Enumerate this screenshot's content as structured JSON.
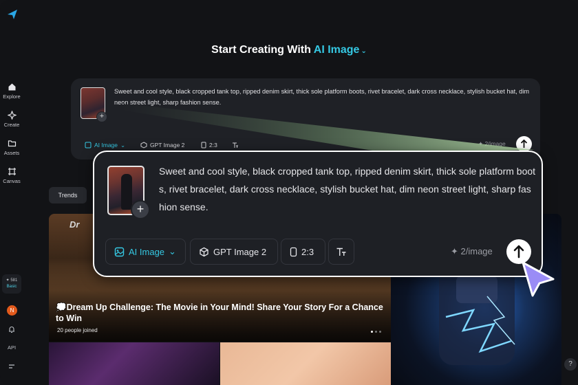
{
  "header": {
    "title_prefix": "Start Creating With",
    "mode": "AI Image"
  },
  "sidebar": {
    "items": [
      {
        "label": "Explore",
        "icon": "home-icon"
      },
      {
        "label": "Create",
        "icon": "sparkle-icon"
      },
      {
        "label": "Assets",
        "icon": "folder-icon"
      },
      {
        "label": "Canvas",
        "icon": "canvas-icon"
      }
    ],
    "credits": {
      "amount": "✦ 581",
      "tier": "Basic"
    },
    "avatar_initial": "N",
    "api_label": "API"
  },
  "prompt": {
    "text": "Sweet and cool style, black cropped tank top, ripped denim skirt, thick sole platform boots, rivet bracelet, dark cross necklace, stylish bucket hat, dim neon street light, sharp fashion sense.",
    "text_small": "Sweet and cool style, black cropped tank top, ripped denim skirt, thick sole platform boots, rivet bracelet, dark cross necklace, stylish bucket hat, dim neon street light, sharp fashion sense.",
    "add_symbol": "+",
    "tools": {
      "mode": "AI Image",
      "model": "GPT Image 2",
      "ratio": "2:3"
    },
    "cost": "✦ 2/image"
  },
  "tabs": {
    "trends": "Trends"
  },
  "feed": {
    "hero_brand": "Dr",
    "hero_title": "💭Dream Up Challenge: The Movie in Your Mind! Share Your Story For a Chance to Win",
    "hero_joined_count": "20",
    "hero_joined_label": "people joined"
  },
  "help_label": "?",
  "colors": {
    "accent": "#35c8e3",
    "background": "#121316",
    "panel": "#1f2126"
  }
}
